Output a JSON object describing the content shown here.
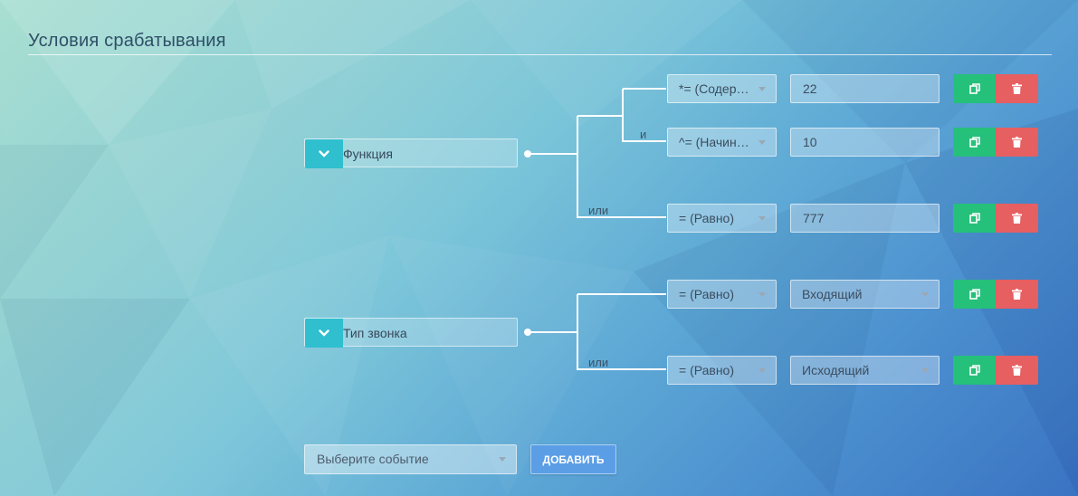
{
  "section": {
    "title": "Условия срабатывания"
  },
  "conditions": [
    {
      "field": "Функция",
      "rows": [
        {
          "operator": "*= (Содержит)",
          "value": "22",
          "value_type": "text"
        },
        {
          "connector": "и",
          "operator": "^= (Начинается с)",
          "value": "10",
          "value_type": "text"
        },
        {
          "connector": "или",
          "operator": "= (Равно)",
          "value": "777",
          "value_type": "text"
        }
      ]
    },
    {
      "field": "Тип звонка",
      "rows": [
        {
          "operator": "= (Равно)",
          "value": "Входящий",
          "value_type": "select"
        },
        {
          "connector": "или",
          "operator": "= (Равно)",
          "value": "Исходящий",
          "value_type": "select"
        }
      ]
    }
  ],
  "footer": {
    "event_placeholder": "Выберите событие",
    "add_label": "ДОБАВИТЬ"
  },
  "icons": {
    "toggle": "chevron-down-icon",
    "copy": "copy-icon",
    "delete": "trash-icon"
  },
  "colors": {
    "toggle": "#2fbfcf",
    "copy": "#25c07a",
    "delete": "#e65f61",
    "add": "#5b9ee6"
  }
}
